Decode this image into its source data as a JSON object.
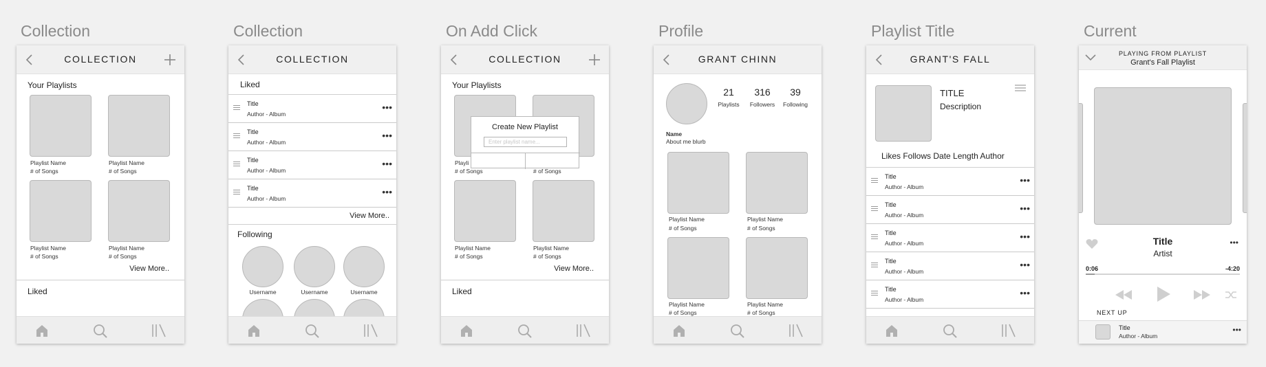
{
  "labels": [
    "Collection",
    "Collection",
    "On Add Click",
    "Profile",
    "Playlist Title",
    "Current"
  ],
  "nav": {
    "home": "home-icon",
    "search": "search-icon",
    "library": "library-icon"
  },
  "s1": {
    "title": "COLLECTION",
    "section": "Your Playlists",
    "playlists": [
      {
        "name": "Playlist Name",
        "songs": "# of Songs"
      },
      {
        "name": "Playlist Name",
        "songs": "# of Songs"
      },
      {
        "name": "Playlist Name",
        "songs": "# of Songs"
      },
      {
        "name": "Playlist Name",
        "songs": "# of Songs"
      }
    ],
    "view_more": "View More..",
    "liked": "Liked"
  },
  "s2": {
    "title": "COLLECTION",
    "liked": "Liked",
    "tracks": [
      {
        "title": "Title",
        "sub": "Author - Album"
      },
      {
        "title": "Title",
        "sub": "Author - Album"
      },
      {
        "title": "Title",
        "sub": "Author - Album"
      },
      {
        "title": "Title",
        "sub": "Author - Album"
      }
    ],
    "view_more": "View More..",
    "following": "Following",
    "users": [
      "Username",
      "Username",
      "Username"
    ]
  },
  "s3": {
    "title": "COLLECTION",
    "section": "Your Playlists",
    "partial_name": "Playli",
    "songs": "# of Songs",
    "playlists": [
      {
        "name": "Playlist Name",
        "songs": "# of Songs"
      },
      {
        "name": "Playlist Name",
        "songs": "# of Songs"
      }
    ],
    "view_more": "View More..",
    "liked": "Liked",
    "modal": {
      "title": "Create New Playlist",
      "placeholder": "Enter playlist name..."
    }
  },
  "s4": {
    "title": "GRANT CHINN",
    "stats": [
      {
        "n": "21",
        "l": "Playlists"
      },
      {
        "n": "316",
        "l": "Followers"
      },
      {
        "n": "39",
        "l": "Following"
      }
    ],
    "name": "Name",
    "about": "About me blurb",
    "playlists": [
      {
        "name": "Playlist Name",
        "songs": "# of Songs"
      },
      {
        "name": "Playlist Name",
        "songs": "# of Songs"
      },
      {
        "name": "Playlist Name",
        "songs": "# of Songs"
      },
      {
        "name": "Playlist Name",
        "songs": "# of Songs"
      }
    ]
  },
  "s5": {
    "title": "GRANT'S FALL",
    "ptitle": "TITLE",
    "desc": "Description",
    "columns": "Likes Follows Date Length Author",
    "tracks": [
      {
        "title": "Title",
        "sub": "Author - Album"
      },
      {
        "title": "Title",
        "sub": "Author - Album"
      },
      {
        "title": "Title",
        "sub": "Author - Album"
      },
      {
        "title": "Title",
        "sub": "Author - Album"
      },
      {
        "title": "Title",
        "sub": "Author - Album"
      }
    ]
  },
  "s6": {
    "header_small": "PLAYING FROM PLAYLIST",
    "header_main": "Grant's Fall Playlist",
    "track": "Title",
    "artist": "Artist",
    "elapsed": "0:06",
    "remaining": "-4:20",
    "progress": 0.06,
    "next_up": "NEXT UP",
    "next_title": "Title",
    "next_sub": "Author - Album"
  }
}
